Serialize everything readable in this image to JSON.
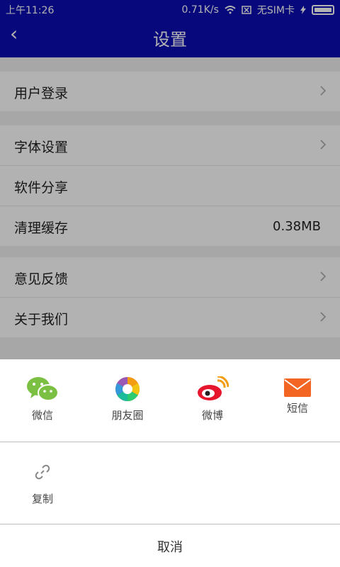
{
  "status_bar": {
    "time": "上午11:26",
    "speed": "0.71K/s",
    "sim": "无SIM卡",
    "battery_level": 1.0,
    "battery_color": "#3ddc84"
  },
  "app_bar": {
    "back_icon": "chevron-left-icon",
    "title": "设置",
    "bg_color": "#0c0cb4"
  },
  "settings": {
    "group1": [
      {
        "label": "用户登录",
        "has_arrow": true
      }
    ],
    "group2": [
      {
        "label": "字体设置",
        "has_arrow": true
      },
      {
        "label": "软件分享",
        "has_arrow": false
      },
      {
        "label": "清理缓存",
        "value": "0.38MB",
        "has_arrow": false
      }
    ],
    "group3": [
      {
        "label": "意见反馈",
        "has_arrow": true
      },
      {
        "label": "关于我们",
        "has_arrow": true
      }
    ]
  },
  "share_sheet": {
    "items": [
      {
        "label": "微信",
        "icon": "wechat-icon"
      },
      {
        "label": "朋友圈",
        "icon": "moments-icon"
      },
      {
        "label": "微博",
        "icon": "weibo-icon"
      },
      {
        "label": "短信",
        "icon": "sms-icon"
      }
    ],
    "copy": {
      "label": "复制",
      "icon": "link-icon"
    },
    "cancel": "取消"
  }
}
